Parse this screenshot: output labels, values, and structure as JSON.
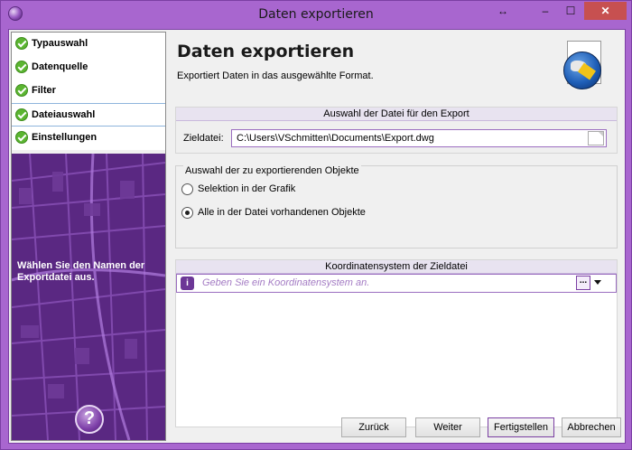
{
  "window": {
    "title": "Daten exportieren",
    "controls": {
      "resize": "↔",
      "minimize": "‒",
      "maximize": "☐",
      "close": "✕"
    }
  },
  "wizard_steps": [
    {
      "label": "Typauswahl",
      "state": "done"
    },
    {
      "label": "Datenquelle",
      "state": "done"
    },
    {
      "label": "Filter",
      "state": "done"
    },
    {
      "label": "Dateiauswahl",
      "state": "active"
    },
    {
      "label": "Einstellungen",
      "state": "done"
    }
  ],
  "sidebar": {
    "hint": "Wählen Sie den Namen der Exportdatei aus.",
    "help_icon": "?"
  },
  "page": {
    "title": "Daten exportieren",
    "subtitle": "Exportiert Daten in das ausgewählte Format."
  },
  "file_group": {
    "header": "Auswahl der Datei für den Export",
    "label": "Zieldatei:",
    "value": "C:\\Users\\VSchmitten\\Documents\\Export.dwg"
  },
  "objects_group": {
    "legend": "Auswahl der zu exportierenden Objekte",
    "options": [
      {
        "label": "Selektion in der Grafik",
        "selected": false
      },
      {
        "label": "Alle in der Datei vorhandenen Objekte",
        "selected": true
      }
    ]
  },
  "crs_group": {
    "header": "Koordinatensystem der Zieldatei",
    "info_icon": "i",
    "placeholder": "Geben Sie ein Koordinatensystem an.",
    "browse_label": "..."
  },
  "buttons": {
    "back": "Zurück",
    "next": "Weiter",
    "finish": "Fertigstellen",
    "cancel": "Abbrechen"
  },
  "colors": {
    "accent": "#a866cf",
    "check": "#5bb531",
    "placeholder": "#a47cc4"
  }
}
